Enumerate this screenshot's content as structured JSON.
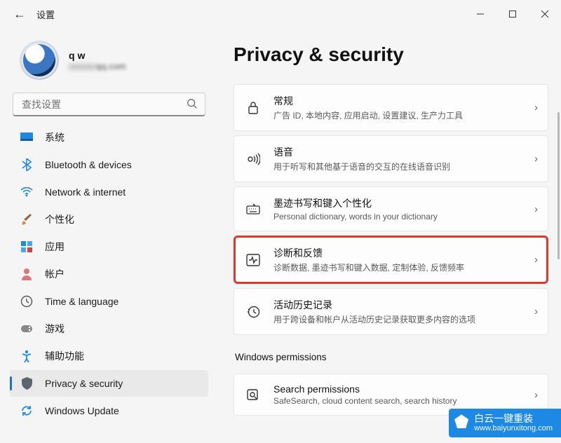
{
  "window": {
    "title": "设置"
  },
  "account": {
    "name": "q w",
    "email_suffix": "qq.com"
  },
  "search": {
    "placeholder": "查找设置"
  },
  "sidebar": {
    "items": [
      {
        "label": "系统"
      },
      {
        "label": "Bluetooth & devices"
      },
      {
        "label": "Network & internet"
      },
      {
        "label": "个性化"
      },
      {
        "label": "应用"
      },
      {
        "label": "帐户"
      },
      {
        "label": "Time & language"
      },
      {
        "label": "游戏"
      },
      {
        "label": "辅助功能"
      },
      {
        "label": "Privacy & security"
      },
      {
        "label": "Windows Update"
      }
    ]
  },
  "page": {
    "title": "Privacy & security",
    "section_label": "Windows permissions"
  },
  "cards": [
    {
      "title": "常规",
      "subtitle": "广告 ID, 本地内容, 应用启动, 设置建议, 生产力工具"
    },
    {
      "title": "语音",
      "subtitle": "用于听写和其他基于语音的交互的在线语音识别"
    },
    {
      "title": "墨迹书写和键入个性化",
      "subtitle": "Personal dictionary, words in your dictionary"
    },
    {
      "title": "诊断和反馈",
      "subtitle": "诊断数据, 墨迹书写和键入数据, 定制体验, 反馈频率"
    },
    {
      "title": "活动历史记录",
      "subtitle": "用于跨设备和帐户从活动历史记录获取更多内容的选项"
    },
    {
      "title": "Search permissions",
      "subtitle": "SafeSearch, cloud content search, search history"
    }
  ],
  "watermark": {
    "line1": "白云一键重装",
    "line2": "www.baiyunxitong.com"
  }
}
